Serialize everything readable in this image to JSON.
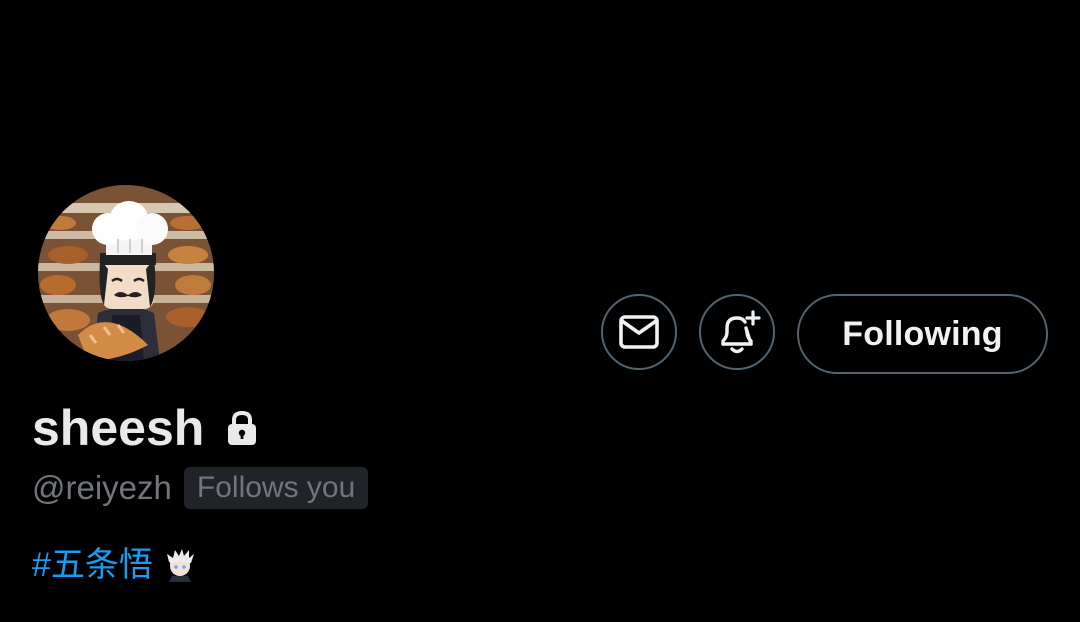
{
  "profile": {
    "display_name": "sheesh",
    "handle": "@reiyezh",
    "follows_you_label": "Follows you",
    "bio_hashtag": "#五条悟"
  },
  "actions": {
    "following_label": "Following"
  },
  "icons": {
    "message": "envelope-icon",
    "notify": "bell-plus-icon",
    "protected": "lock-icon"
  },
  "colors": {
    "background": "#000000",
    "text_primary": "#e7e9ea",
    "text_secondary": "#71767b",
    "link": "#1d9bf0",
    "border": "#536471",
    "badge_bg": "#202327"
  }
}
